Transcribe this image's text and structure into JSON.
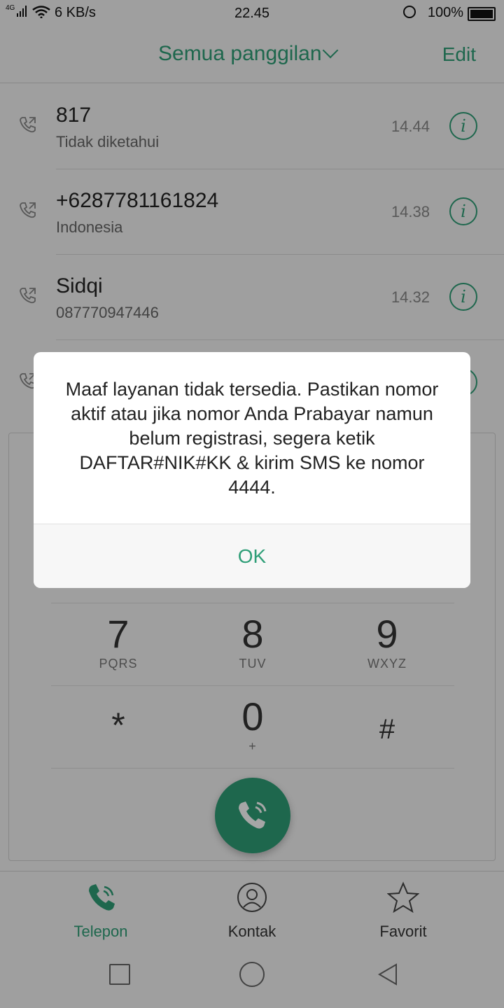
{
  "status_bar": {
    "network": "4G",
    "speed": "6 KB/s",
    "time": "22.45",
    "battery": "100%"
  },
  "header": {
    "title": "Semua panggilan",
    "edit_label": "Edit"
  },
  "calls": [
    {
      "name": "817",
      "sub": "Tidak diketahui",
      "time": "14.44"
    },
    {
      "name": "+6287781161824",
      "sub": "Indonesia",
      "time": "14.38"
    },
    {
      "name": "Sidqi",
      "sub": "087770947446",
      "time": "14.32"
    }
  ],
  "keypad": {
    "row3": [
      {
        "digit": "7",
        "letters": "PQRS"
      },
      {
        "digit": "8",
        "letters": "TUV"
      },
      {
        "digit": "9",
        "letters": "WXYZ"
      }
    ],
    "row4": [
      {
        "digit": "*",
        "letters": ""
      },
      {
        "digit": "0",
        "letters": "+"
      },
      {
        "digit": "#",
        "letters": ""
      }
    ]
  },
  "tabs": [
    {
      "label": "Telepon",
      "icon": "phone-icon",
      "active": true
    },
    {
      "label": "Kontak",
      "icon": "contact-icon",
      "active": false
    },
    {
      "label": "Favorit",
      "icon": "star-icon",
      "active": false
    }
  ],
  "dialog": {
    "message": "Maaf layanan tidak tersedia. Pastikan nomor aktif atau jika nomor Anda Prabayar namun belum registrasi, segera ketik DAFTAR#NIK#KK & kirim SMS ke nomor 4444.",
    "ok_label": "OK"
  },
  "colors": {
    "accent": "#2e9e77"
  }
}
